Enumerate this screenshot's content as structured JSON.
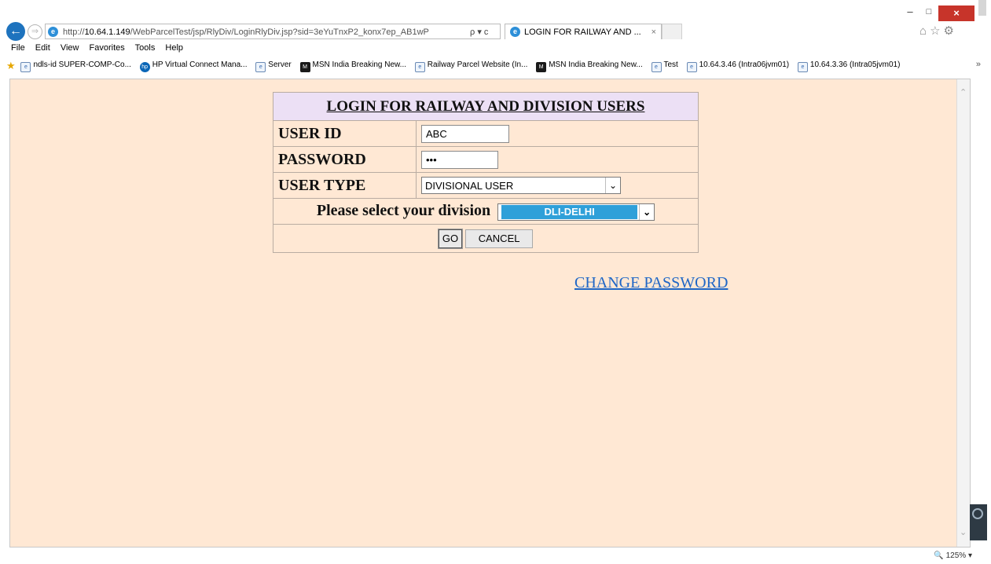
{
  "browser": {
    "url_prefix": "http://",
    "url_host": "10.64.1.149",
    "url_path": "/WebParcelTest/jsp/RlyDiv/LoginRlyDiv.jsp?sid=3eYuTnxP2_konx7ep_AB1wP",
    "tab_title": "LOGIN FOR RAILWAY AND ...",
    "tab_close": "×",
    "search_controls": "ρ ▾ c",
    "toolbar_icons": "⌂☆⚙",
    "zoom": "125%"
  },
  "window_controls": {
    "minimize": "–",
    "maximize": "□",
    "close": "×"
  },
  "menu": [
    "File",
    "Edit",
    "View",
    "Favorites",
    "Tools",
    "Help"
  ],
  "favorites": [
    {
      "label": "ndls-id SUPER-COMP-Co...",
      "icon": "ie-page-icon"
    },
    {
      "label": "HP Virtual Connect Mana...",
      "icon": "hp-icon"
    },
    {
      "label": "Server",
      "icon": "ie-page-icon"
    },
    {
      "label": "MSN India  Breaking New...",
      "icon": "msn-icon"
    },
    {
      "label": "Railway Parcel Website (In...",
      "icon": "ie-page-icon"
    },
    {
      "label": "MSN India  Breaking New...",
      "icon": "msn-icon"
    },
    {
      "label": "Test",
      "icon": "ie-page-icon"
    },
    {
      "label": "10.64.3.46 (Intra06jvm01)",
      "icon": "ie-page-icon"
    },
    {
      "label": "10.64.3.36 (Intra05jvm01)",
      "icon": "ie-page-icon"
    }
  ],
  "form": {
    "title": "LOGIN FOR RAILWAY AND DIVISION USERS",
    "user_id_label": "USER ID",
    "user_id_value": "ABC",
    "password_label": "PASSWORD",
    "password_value": "•••",
    "user_type_label": "USER TYPE",
    "user_type_value": "DIVISIONAL USER",
    "division_label": "Please select your division",
    "division_value": "DLI-DELHI",
    "go_label": "GO",
    "cancel_label": "CANCEL",
    "change_password_label": "CHANGE PASSWORD"
  },
  "colors": {
    "page_background": "#ffe8d4",
    "title_background": "#ece0f5",
    "link": "#1f66c6",
    "select_highlight": "#2fa0d9"
  }
}
